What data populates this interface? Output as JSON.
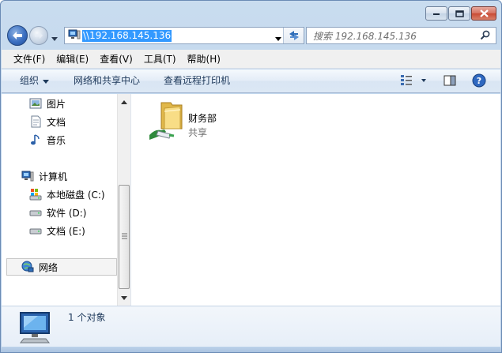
{
  "window": {
    "caption": {
      "minimize_icon": "minimize-icon",
      "maximize_icon": "maximize-icon",
      "close_icon": "close-icon"
    }
  },
  "nav": {
    "address_value": "\\\\192.168.145.136",
    "search_placeholder": "搜索 192.168.145.136"
  },
  "menubar": {
    "items": [
      "文件(F)",
      "编辑(E)",
      "查看(V)",
      "工具(T)",
      "帮助(H)"
    ]
  },
  "commandbar": {
    "organize": "组织",
    "network_center": "网络和共享中心",
    "remote_printers": "查看远程打印机"
  },
  "navpane": {
    "libraries": [
      {
        "label": "图片",
        "icon": "pictures-icon"
      },
      {
        "label": "文档",
        "icon": "documents-icon"
      },
      {
        "label": "音乐",
        "icon": "music-icon"
      }
    ],
    "computer": {
      "label": "计算机",
      "icon": "computer-icon"
    },
    "drives": [
      {
        "label": "本地磁盘 (C:)",
        "icon": "system-drive-icon"
      },
      {
        "label": "软件 (D:)",
        "icon": "drive-icon"
      },
      {
        "label": "文档 (E:)",
        "icon": "drive-icon"
      }
    ],
    "network": {
      "label": "网络",
      "icon": "network-icon"
    }
  },
  "content": {
    "items": [
      {
        "name": "财务部",
        "type": "共享",
        "icon": "shared-folder-icon"
      }
    ]
  },
  "details": {
    "count_text": "1 个对象"
  },
  "colors": {
    "selection": "#3399ff",
    "command_text": "#1e395b"
  }
}
